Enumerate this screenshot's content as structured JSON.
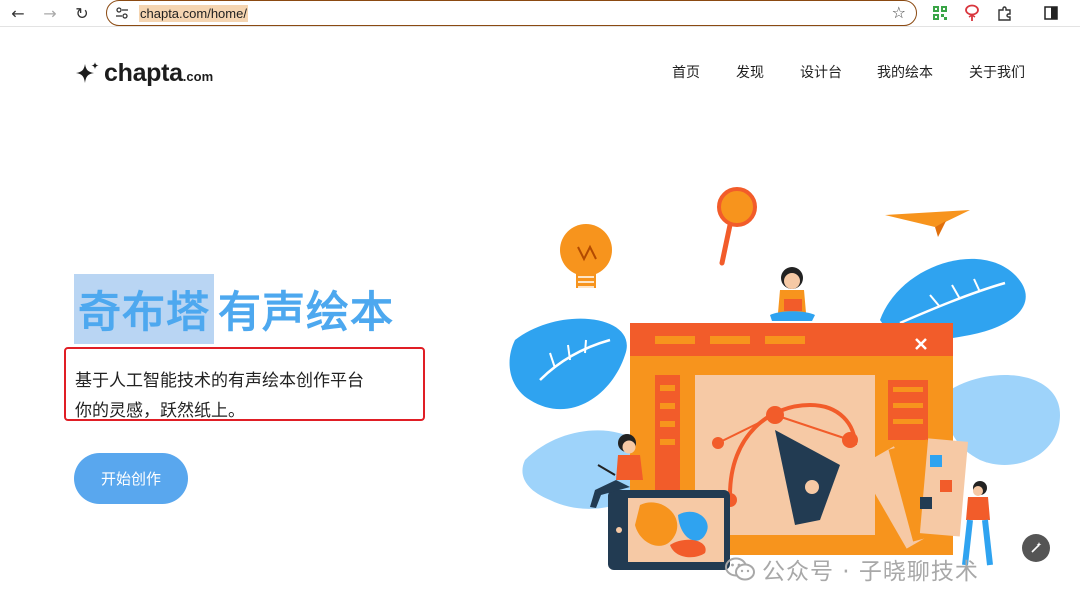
{
  "browser": {
    "url": "chapta.com/home/",
    "back_glyph": "←",
    "forward_glyph": "→",
    "reload_glyph": "↻",
    "bookmark_glyph": "☆"
  },
  "header": {
    "logo_name": "chapta",
    "logo_suffix": ".com",
    "nav": [
      "首页",
      "发现",
      "设计台",
      "我的绘本",
      "关于我们"
    ]
  },
  "hero": {
    "title_highlight": "奇布塔",
    "title_rest": "有声绘本",
    "desc_line1": "基于人工智能技术的有声绘本创作平台",
    "desc_line2": "你的灵感，跃然纸上。",
    "cta_label": "开始创作"
  },
  "watermark": {
    "text": "公众号 · 子晓聊技术"
  },
  "colors": {
    "accent": "#59a7ee",
    "title": "#4da8ef",
    "highlight_box": "#e01e25",
    "illustration_orange": "#f7941d",
    "illustration_blue": "#2fa3f0"
  },
  "icons": [
    "back-arrow-icon",
    "forward-arrow-icon",
    "reload-icon",
    "site-info-icon",
    "bookmark-star-icon",
    "extension-qr-icon",
    "extension-pin-icon",
    "extensions-puzzle-icon",
    "side-panel-icon",
    "logo-sparkle-icon",
    "wechat-icon",
    "magic-wand-icon"
  ]
}
